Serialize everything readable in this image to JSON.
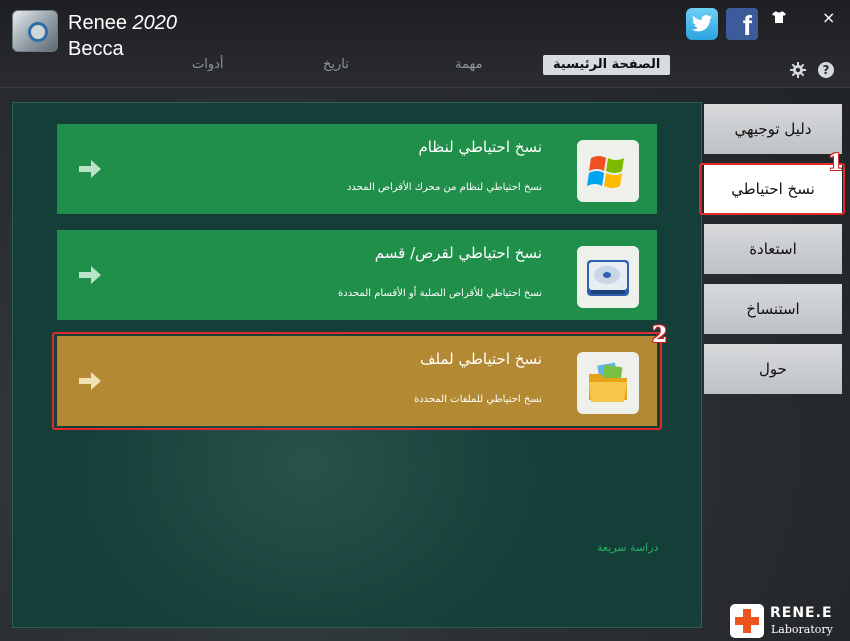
{
  "header": {
    "app_name": "Renee",
    "app_version": "2020",
    "user": "Becca",
    "tabs": [
      {
        "label": "أدوات"
      },
      {
        "label": "تاريخ"
      },
      {
        "label": "مهمة"
      },
      {
        "label": "الصفحة الرئيسية",
        "active": true
      }
    ],
    "close_glyph": "×",
    "help_glyph": "?",
    "facebook_glyph": "f"
  },
  "main": {
    "cards": [
      {
        "title": "نسخ احتياطي لنظام",
        "description": "نسخ احتياطي لنظام من محرك الأقراص المحدد",
        "icon": "windows-logo-icon",
        "color": "#1f8f4a"
      },
      {
        "title": "نسخ احتياطي لقرص/ قسم",
        "description": "نسخ احتياطي للأقراص الصلبة أو الأقسام المحددة",
        "icon": "hard-disk-icon",
        "color": "#1f8f4a"
      },
      {
        "title": "نسخ احتياطي لملف",
        "description": "نسخ احتياطي للملفات المحددة",
        "icon": "folder-icon",
        "color": "#b38a33"
      }
    ],
    "quick_link": "دراسة سريعة"
  },
  "sidebar": {
    "items": [
      {
        "label": "دليل توجيهي"
      },
      {
        "label": "نسخ احتياطي",
        "active": true
      },
      {
        "label": "استعادة"
      },
      {
        "label": "استنساخ"
      },
      {
        "label": "حول"
      }
    ]
  },
  "annotations": {
    "badge_1": "1",
    "badge_2": "2"
  },
  "brand": {
    "name": "RENE.E",
    "subtitle": "Laboratory"
  },
  "colors": {
    "panel": "#143e38",
    "card_green": "#1f8f4a",
    "card_gold": "#b38a33",
    "highlight": "#e02b2b",
    "quick_link": "#23b266"
  }
}
